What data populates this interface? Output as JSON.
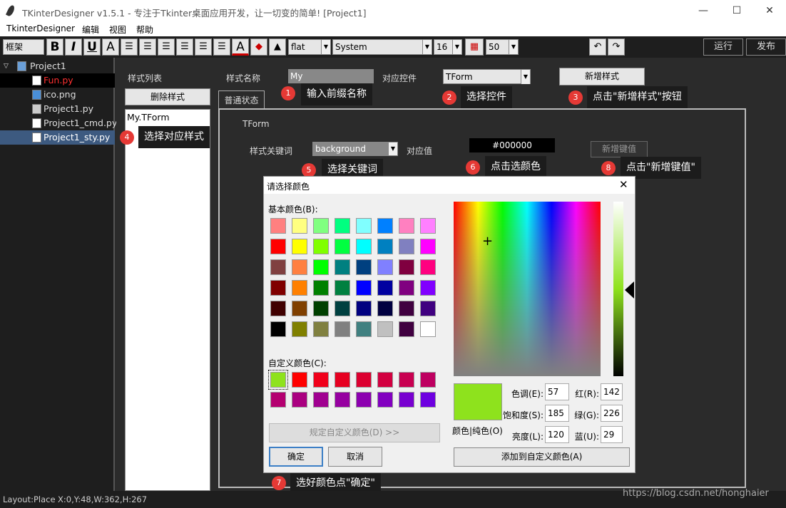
{
  "window": {
    "title": "TKinterDesigner v1.5.1 - 专注于Tkinter桌面应用开发，让一切变的简单!    [Project1]",
    "minimize": "—",
    "maximize": "☐",
    "close": "✕"
  },
  "menu": [
    "TkinterDesigner",
    "编辑",
    "视图",
    "帮助"
  ],
  "toolbar": {
    "frame_label": "框架",
    "bold": "B",
    "italic": "I",
    "underline": "U",
    "font_a": "A",
    "color_a": "A",
    "relief": "flat",
    "font": "System",
    "size": "16",
    "width_val": "50",
    "run": "运行",
    "publish": "发布"
  },
  "tree": {
    "root": "Project1",
    "items": [
      {
        "name": "Fun.py",
        "color": "#ff3030",
        "type": "py"
      },
      {
        "name": "ico.png",
        "color": "#dddddd",
        "type": "img"
      },
      {
        "name": "Project1.py",
        "color": "#dddddd",
        "type": "win"
      },
      {
        "name": "Project1_cmd.py",
        "color": "#dddddd",
        "type": "py"
      },
      {
        "name": "Project1_sty.py",
        "color": "#ffffff",
        "type": "py"
      }
    ]
  },
  "style_panel": {
    "list_label": "样式列表",
    "delete_btn": "删除样式",
    "list_items": [
      "My.TForm"
    ],
    "name_label": "样式名称",
    "name_value": "My",
    "control_label": "对应控件",
    "control_value": "TForm",
    "add_style_btn": "新增样式",
    "tab": "普通状态",
    "group": "TForm",
    "keyword_label": "样式关键词",
    "keyword_value": "background",
    "value_label": "对应值",
    "value_value": "#000000",
    "add_key_btn": "新增键值"
  },
  "annotations": [
    {
      "n": "1",
      "text": "输入前缀名称"
    },
    {
      "n": "2",
      "text": "选择控件"
    },
    {
      "n": "3",
      "text": "点击\"新增样式\"按钮"
    },
    {
      "n": "4",
      "text": "选择对应样式"
    },
    {
      "n": "5",
      "text": "选择关键词"
    },
    {
      "n": "6",
      "text": "点击选颜色"
    },
    {
      "n": "7",
      "text": "选好颜色点\"确定\""
    },
    {
      "n": "8",
      "text": "点击\"新增键值\""
    }
  ],
  "color_dialog": {
    "title": "请选择颜色",
    "basic_label": "基本颜色(B):",
    "custom_label": "自定义颜色(C):",
    "define_btn": "规定自定义颜色(D) >>",
    "ok": "确定",
    "cancel": "取消",
    "color_solid": "颜色|纯色(O)",
    "hue_label": "色调(E):",
    "hue": "57",
    "sat_label": "饱和度(S):",
    "sat": "185",
    "lum_label": "亮度(L):",
    "lum": "120",
    "red_label": "红(R):",
    "red": "142",
    "green_label": "绿(G):",
    "green": "226",
    "blue_label": "蓝(U):",
    "blue": "29",
    "add_custom_btn": "添加到自定义颜色(A)",
    "selected_color": "#8ee21d",
    "basic_colors": [
      "#ff8080",
      "#ffff80",
      "#80ff80",
      "#00ff80",
      "#80ffff",
      "#0080ff",
      "#ff80c0",
      "#ff80ff",
      "#ff0000",
      "#ffff00",
      "#80ff00",
      "#00ff40",
      "#00ffff",
      "#0080c0",
      "#8080c0",
      "#ff00ff",
      "#804040",
      "#ff8040",
      "#00ff00",
      "#008080",
      "#004080",
      "#8080ff",
      "#800040",
      "#ff0080",
      "#800000",
      "#ff8000",
      "#008000",
      "#008040",
      "#0000ff",
      "#0000a0",
      "#800080",
      "#8000ff",
      "#400000",
      "#804000",
      "#004000",
      "#004040",
      "#000080",
      "#000040",
      "#400040",
      "#400080",
      "#000000",
      "#808000",
      "#808040",
      "#808080",
      "#408080",
      "#c0c0c0",
      "#400040",
      "#ffffff"
    ],
    "custom_colors": [
      "#8ee21d",
      "#ff0000",
      "#f0001a",
      "#e60020",
      "#dc0030",
      "#d20040",
      "#c80050",
      "#be0060",
      "#b40070",
      "#aa0080",
      "#a00090",
      "#9600a0",
      "#8c00b0",
      "#8200c0",
      "#7800d0",
      "#6e00e0"
    ]
  },
  "status": {
    "layout": "Layout:Place",
    "coords": "X:0,Y:48,W:362,H:267"
  },
  "watermark": "https://blog.csdn.net/honghaier"
}
